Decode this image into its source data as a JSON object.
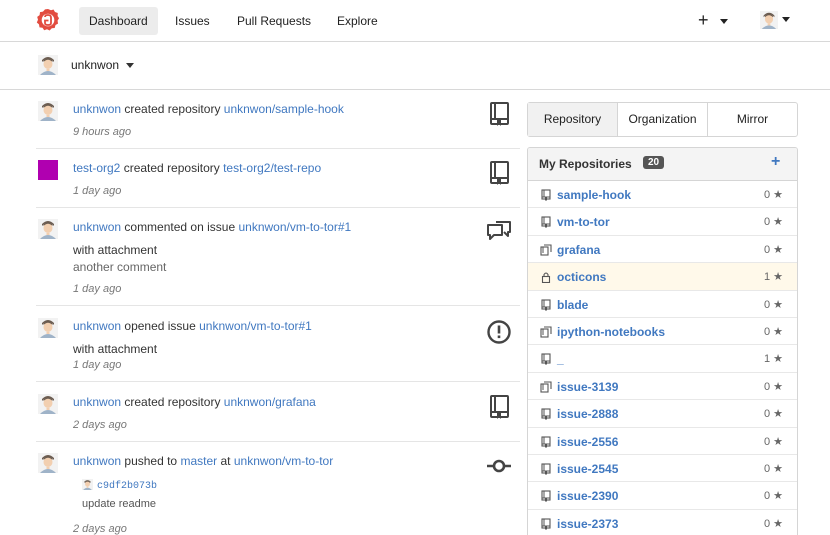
{
  "nav": {
    "items": [
      "Dashboard",
      "Issues",
      "Pull Requests",
      "Explore"
    ],
    "plus": "+"
  },
  "context": {
    "user": "unknwon"
  },
  "feed": [
    {
      "actor": "unknwon",
      "action": "created repository",
      "target": "unknwon/sample-hook",
      "time": "9 hours ago",
      "icon": "book-icon"
    },
    {
      "actor": "test-org2",
      "action": "created repository",
      "target": "test-org2/test-repo",
      "time": "1 day ago",
      "icon": "book-icon"
    },
    {
      "actor": "unknwon",
      "action": "commented on issue",
      "target": "unknwon/vm-to-tor#1",
      "body1": "with attachment",
      "body2": "another comment",
      "time": "1 day ago",
      "icon": "comment-icon"
    },
    {
      "actor": "unknwon",
      "action": "opened issue",
      "target": "unknwon/vm-to-tor#1",
      "body1": "with attachment",
      "time": "1 day ago",
      "icon": "issue-icon"
    },
    {
      "actor": "unknwon",
      "action": "created repository",
      "target": "unknwon/grafana",
      "time": "2 days ago",
      "icon": "book-icon"
    },
    {
      "actor": "unknwon",
      "action": "pushed to",
      "branch": "master",
      "at": "at",
      "target": "unknwon/vm-to-tor",
      "commit_sha": "c9df2b073b",
      "commit_msg": "update readme",
      "time": "2 days ago",
      "icon": "commit-icon"
    }
  ],
  "tabs": [
    "Repository",
    "Organization",
    "Mirror"
  ],
  "repos": {
    "title": "My Repositories",
    "count": "20",
    "add": "+",
    "items": [
      {
        "name": "sample-hook",
        "stars": "0",
        "type": "repo"
      },
      {
        "name": "vm-to-tor",
        "stars": "0",
        "type": "repo"
      },
      {
        "name": "grafana",
        "stars": "0",
        "type": "fork"
      },
      {
        "name": "octicons",
        "stars": "1",
        "type": "private"
      },
      {
        "name": "blade",
        "stars": "0",
        "type": "repo"
      },
      {
        "name": "ipython-notebooks",
        "stars": "0",
        "type": "fork"
      },
      {
        "name": "_",
        "stars": "1",
        "type": "repo"
      },
      {
        "name": "issue-3139",
        "stars": "0",
        "type": "fork"
      },
      {
        "name": "issue-2888",
        "stars": "0",
        "type": "repo"
      },
      {
        "name": "issue-2556",
        "stars": "0",
        "type": "repo"
      },
      {
        "name": "issue-2545",
        "stars": "0",
        "type": "repo"
      },
      {
        "name": "issue-2390",
        "stars": "0",
        "type": "repo"
      },
      {
        "name": "issue-2373",
        "stars": "0",
        "type": "repo"
      }
    ]
  },
  "colors": {
    "accent": "#4078c0",
    "logo": "#e24c40",
    "org_avatar": "#b000b0",
    "private_row": "#fff9ea"
  }
}
